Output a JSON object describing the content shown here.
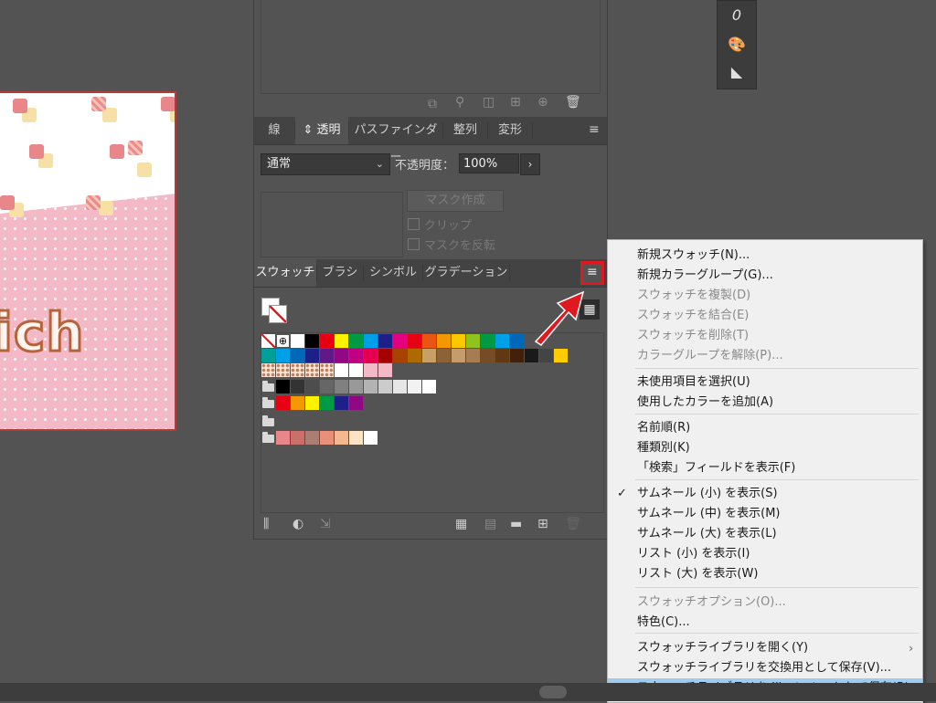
{
  "transparency_panel": {
    "tabs": [
      {
        "label": "線"
      },
      {
        "label": "⇕ 透明"
      },
      {
        "label": "パスファインダー"
      },
      {
        "label": "整列"
      },
      {
        "label": "変形"
      }
    ],
    "blend_mode": "通常",
    "opacity_label": "不透明度：",
    "opacity_value": "100%",
    "mask_button": "マスク作成",
    "clip_label": "クリップ",
    "invert_label": "マスクを反転"
  },
  "swatches_panel": {
    "tabs": [
      {
        "label": "スウォッチ"
      },
      {
        "label": "ブラシ"
      },
      {
        "label": "シンボル"
      },
      {
        "label": "グラデーション"
      }
    ],
    "row1": [
      "none",
      "registration",
      "#ffffff",
      "#000000",
      "#e60012",
      "#fff100",
      "#009944",
      "#00a0e9",
      "#1d2088",
      "#e4007f",
      "#e60012",
      "#ea5514",
      "#f39800",
      "#fcc800",
      "#8fc31f",
      "#009944",
      "#00a0e9",
      "#0068b7"
    ],
    "row2": [
      "#009e96",
      "#00a0e9",
      "#0068b7",
      "#1d2088",
      "#601986",
      "#920783",
      "#be0081",
      "#e5004f",
      "#a40000",
      "#a84200",
      "#ac6a00",
      "#c9a063",
      "#8c6239",
      "#c69c6d",
      "#a67c52",
      "#754c24",
      "#603813",
      "#42210b",
      "#1a1a1a",
      "#444444",
      "#ffcc00"
    ],
    "row3": [
      "pattern",
      "pattern",
      "pattern",
      "pattern",
      "pattern",
      "#ffffff",
      "#ffffff",
      "#f3b9c6",
      "#f3b9c6"
    ],
    "group1": [
      "#000000",
      "#333333",
      "#4d4d4d",
      "#666666",
      "#808080",
      "#999999",
      "#b3b3b3",
      "#cccccc",
      "#e6e6e6",
      "#f2f2f2",
      "#ffffff"
    ],
    "group2": [
      "#e60012",
      "#f39800",
      "#fff100",
      "#009944",
      "#1d2088",
      "#920783"
    ],
    "group4": [
      "#e9868a",
      "#c9706b",
      "#a97f74",
      "#e9907a",
      "#f5b98f",
      "#fde3c3",
      "#ffffff"
    ]
  },
  "artwork": {
    "text": "ich"
  },
  "context_menu": {
    "items": [
      {
        "label": "新規スウォッチ(N)...",
        "enabled": true
      },
      {
        "label": "新規カラーグループ(G)...",
        "enabled": true
      },
      {
        "label": "スウォッチを複製(D)",
        "enabled": false
      },
      {
        "label": "スウォッチを結合(E)",
        "enabled": false
      },
      {
        "label": "スウォッチを削除(T)",
        "enabled": false
      },
      {
        "label": "カラーグループを解除(P)...",
        "enabled": false
      },
      {
        "label": "未使用項目を選択(U)",
        "enabled": true
      },
      {
        "label": "使用したカラーを追加(A)",
        "enabled": true
      },
      {
        "label": "名前順(R)",
        "enabled": true
      },
      {
        "label": "種類別(K)",
        "enabled": true
      },
      {
        "label": "「検索」フィールドを表示(F)",
        "enabled": true
      },
      {
        "label": "サムネール (小) を表示(S)",
        "enabled": true,
        "checked": true
      },
      {
        "label": "サムネール (中) を表示(M)",
        "enabled": true
      },
      {
        "label": "サムネール (大) を表示(L)",
        "enabled": true
      },
      {
        "label": "リスト (小) を表示(I)",
        "enabled": true
      },
      {
        "label": "リスト (大) を表示(W)",
        "enabled": true
      },
      {
        "label": "スウォッチオプション(O)...",
        "enabled": false
      },
      {
        "label": "特色(C)...",
        "enabled": true
      },
      {
        "label": "スウォッチライブラリを開く(Y)",
        "enabled": true,
        "submenu": true
      },
      {
        "label": "スウォッチライブラリを交換用として保存(V)...",
        "enabled": true
      },
      {
        "label": "スウォッチライブラリを Illustrator として保存(B)...",
        "enabled": true,
        "highlighted": true
      }
    ]
  },
  "colors": {
    "accent_red": "#e0191f",
    "menu_highlight": "#9bccf2",
    "underline": "#d8141c"
  }
}
